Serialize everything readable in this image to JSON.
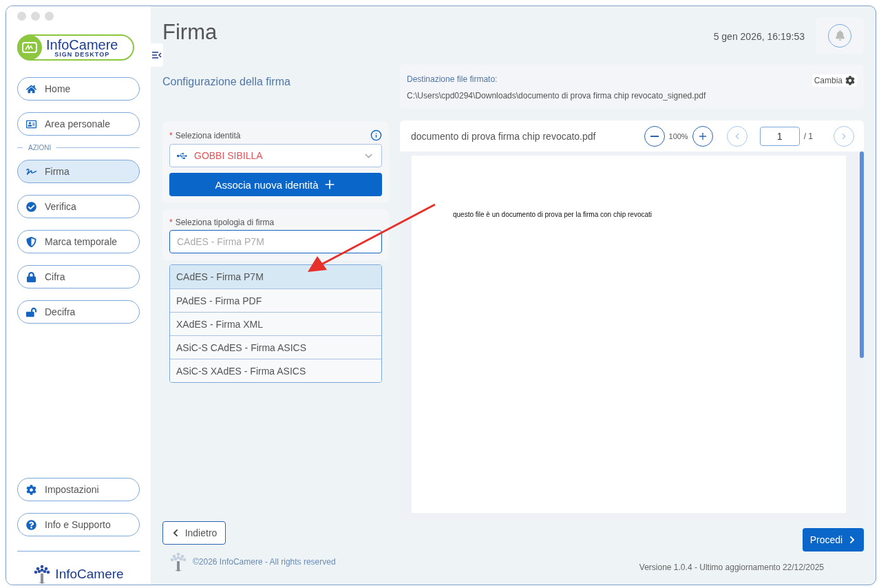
{
  "window": {
    "title": "Firma",
    "datetime": "5 gen 2026, 16:19:53"
  },
  "sidebar": {
    "logo": {
      "name": "InfoCamere",
      "subtitle": "SIGN DESKTOP"
    },
    "top_items": [
      {
        "label": "Home",
        "selected": false
      },
      {
        "label": "Area personale",
        "selected": false
      }
    ],
    "section_label": "AZIONI",
    "action_items": [
      {
        "label": "Firma",
        "selected": true
      },
      {
        "label": "Verifica",
        "selected": false
      },
      {
        "label": "Marca temporale",
        "selected": false
      },
      {
        "label": "Cifra",
        "selected": false
      },
      {
        "label": "Decifra",
        "selected": false
      }
    ],
    "bottom_items": [
      {
        "label": "Impostazioni",
        "selected": false
      },
      {
        "label": "Info e Supporto",
        "selected": false
      }
    ],
    "footer_logo": "InfoCamere"
  },
  "config": {
    "heading": "Configurazione della firma",
    "identity": {
      "required_mark": "*",
      "label": "Seleziona identità",
      "value": "GOBBI SIBILLA"
    },
    "associate_button": "Associa nuova identità",
    "signature_type": {
      "required_mark": "*",
      "label": "Seleziona tipologia di firma",
      "value": "CAdES - Firma P7M",
      "options": [
        {
          "label": "CAdES - Firma P7M",
          "selected": true
        },
        {
          "label": "PAdES - Firma PDF",
          "selected": false
        },
        {
          "label": "XAdES - Firma XML",
          "selected": false
        },
        {
          "label": "ASiC-S CAdES - Firma ASICS",
          "selected": false
        },
        {
          "label": "ASiC-S XAdES - Firma ASICS",
          "selected": false
        }
      ]
    }
  },
  "destination": {
    "label": "Destinazione file firmato:",
    "path": "C:\\Users\\cpd0294\\Downloads\\documento di prova firma chip revocato_signed.pdf",
    "change_button": "Cambia"
  },
  "viewer": {
    "filename": "documento di prova firma chip revocato.pdf",
    "zoom": "100%",
    "page": "1",
    "page_total": "/ 1",
    "page_text": "questo file è un documento di prova per la firma con chip revocati"
  },
  "footer": {
    "back_button": "Indietro",
    "next_button": "Procedi",
    "copyright": "©2026 InfoCamere - All rights reserved",
    "version": "Versione 1.0.4 - Ultimo aggiornamento 22/12/2025"
  }
}
